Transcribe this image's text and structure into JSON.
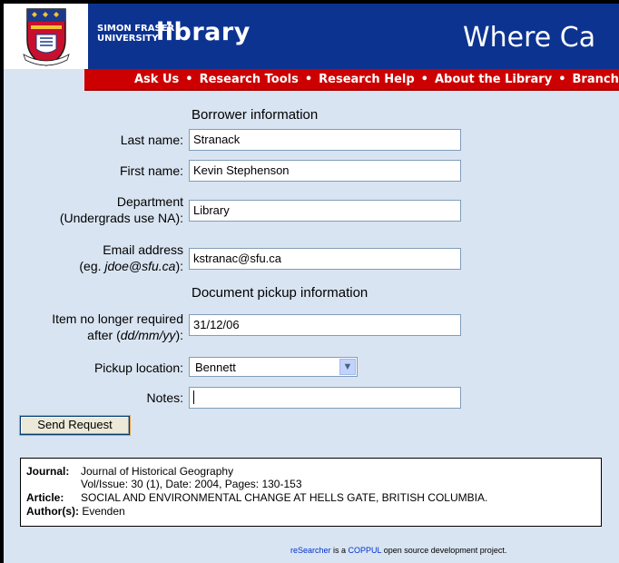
{
  "header": {
    "university_line1": "SIMON FRASER",
    "university_line2": "UNIVERSITY",
    "library_word": "library",
    "page_title": "Where Ca"
  },
  "nav": {
    "items": [
      "Ask Us",
      "Research Tools",
      "Research Help",
      "About the Library",
      "Branches"
    ],
    "separator": "•"
  },
  "form": {
    "borrower_heading": "Borrower information",
    "last_name_label": "Last name:",
    "last_name_value": "Stranack",
    "first_name_label": "First name:",
    "first_name_value": "Kevin Stephenson",
    "department_label_1": "Department",
    "department_label_2": "(Undergrads use NA):",
    "department_value": "Library",
    "email_label_1": "Email address",
    "email_label_2_prefix": "(eg. ",
    "email_label_2_example": "jdoe@sfu.ca",
    "email_label_2_suffix": "):",
    "email_value": "kstranac@sfu.ca",
    "pickup_heading": "Document pickup information",
    "item_label_1": "Item no longer required",
    "item_label_2_prefix": "after (",
    "item_label_2_format": "dd/mm/yy",
    "item_label_2_suffix": "):",
    "item_value": "31/12/06",
    "pickup_location_label": "Pickup location:",
    "pickup_location_value": "Bennett",
    "notes_label": "Notes:",
    "notes_value": "",
    "send_button": "Send Request"
  },
  "citation": {
    "journal_label": "Journal:",
    "journal_value": "Journal of Historical Geography",
    "vol_issue_line": "Vol/Issue: 30 (1), Date: 2004, Pages: 130-153",
    "article_label": "Article:",
    "article_value": "SOCIAL AND ENVIRONMENTAL CHANGE AT HELLS GATE, BRITISH COLUMBIA.",
    "authors_label": "Author(s):",
    "authors_value": "Evenden"
  },
  "footer": {
    "link1": "reSearcher",
    "text1": " is a ",
    "link2": "COPPUL",
    "text2": " open source development project."
  },
  "colors": {
    "header_blue": "#0d3391",
    "nav_red": "#cc0000",
    "page_bg": "#d9e4f2"
  }
}
